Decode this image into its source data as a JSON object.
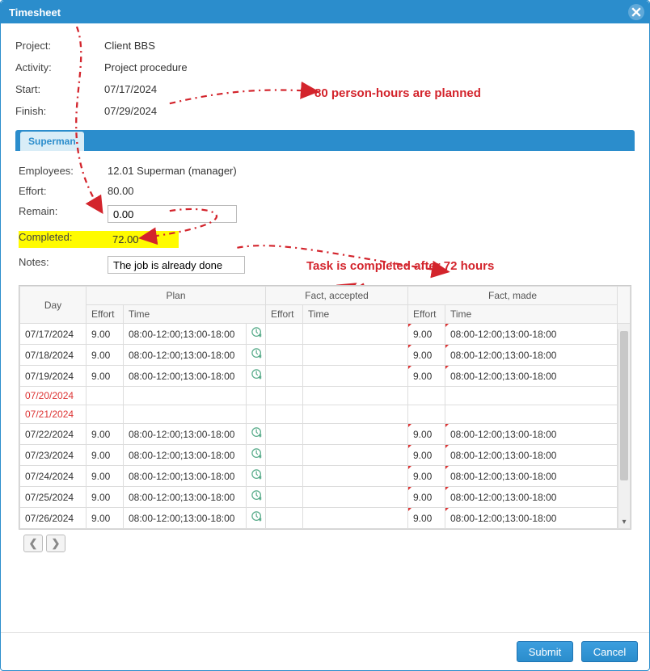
{
  "dialog": {
    "title": "Timesheet"
  },
  "summary": {
    "project_label": "Project:",
    "project_value": "Client BBS",
    "activity_label": "Activity:",
    "activity_value": "Project procedure",
    "start_label": "Start:",
    "start_value": "07/17/2024",
    "finish_label": "Finish:",
    "finish_value": "07/29/2024"
  },
  "tab": {
    "label": "Superman"
  },
  "panel": {
    "employees_label": "Employees:",
    "employees_value": "12.01 Superman (manager)",
    "effort_label": "Effort:",
    "effort_value": "80.00",
    "remain_label": "Remain:",
    "remain_value": "0.00",
    "completed_label": "Completed:",
    "completed_value": "72.00",
    "notes_label": "Notes:",
    "notes_value": "The job is already done"
  },
  "grid": {
    "headers": {
      "day": "Day",
      "plan": "Plan",
      "fact_accepted": "Fact, accepted",
      "fact_made": "Fact, made",
      "effort": "Effort",
      "time": "Time"
    },
    "rows": [
      {
        "day": "07/17/2024",
        "plan_effort": "9.00",
        "plan_time": "08:00-12:00;13:00-18:00",
        "fa_effort": "",
        "fa_time": "",
        "fm_effort": "9.00",
        "fm_time": "08:00-12:00;13:00-18:00",
        "weekend": false
      },
      {
        "day": "07/18/2024",
        "plan_effort": "9.00",
        "plan_time": "08:00-12:00;13:00-18:00",
        "fa_effort": "",
        "fa_time": "",
        "fm_effort": "9.00",
        "fm_time": "08:00-12:00;13:00-18:00",
        "weekend": false
      },
      {
        "day": "07/19/2024",
        "plan_effort": "9.00",
        "plan_time": "08:00-12:00;13:00-18:00",
        "fa_effort": "",
        "fa_time": "",
        "fm_effort": "9.00",
        "fm_time": "08:00-12:00;13:00-18:00",
        "weekend": false
      },
      {
        "day": "07/20/2024",
        "plan_effort": "",
        "plan_time": "",
        "fa_effort": "",
        "fa_time": "",
        "fm_effort": "",
        "fm_time": "",
        "weekend": true
      },
      {
        "day": "07/21/2024",
        "plan_effort": "",
        "plan_time": "",
        "fa_effort": "",
        "fa_time": "",
        "fm_effort": "",
        "fm_time": "",
        "weekend": true
      },
      {
        "day": "07/22/2024",
        "plan_effort": "9.00",
        "plan_time": "08:00-12:00;13:00-18:00",
        "fa_effort": "",
        "fa_time": "",
        "fm_effort": "9.00",
        "fm_time": "08:00-12:00;13:00-18:00",
        "weekend": false
      },
      {
        "day": "07/23/2024",
        "plan_effort": "9.00",
        "plan_time": "08:00-12:00;13:00-18:00",
        "fa_effort": "",
        "fa_time": "",
        "fm_effort": "9.00",
        "fm_time": "08:00-12:00;13:00-18:00",
        "weekend": false
      },
      {
        "day": "07/24/2024",
        "plan_effort": "9.00",
        "plan_time": "08:00-12:00;13:00-18:00",
        "fa_effort": "",
        "fa_time": "",
        "fm_effort": "9.00",
        "fm_time": "08:00-12:00;13:00-18:00",
        "weekend": false
      },
      {
        "day": "07/25/2024",
        "plan_effort": "9.00",
        "plan_time": "08:00-12:00;13:00-18:00",
        "fa_effort": "",
        "fa_time": "",
        "fm_effort": "9.00",
        "fm_time": "08:00-12:00;13:00-18:00",
        "weekend": false
      },
      {
        "day": "07/26/2024",
        "plan_effort": "9.00",
        "plan_time": "08:00-12:00;13:00-18:00",
        "fa_effort": "",
        "fa_time": "",
        "fm_effort": "9.00",
        "fm_time": "08:00-12:00;13:00-18:00",
        "weekend": false
      }
    ]
  },
  "footer": {
    "submit": "Submit",
    "cancel": "Cancel"
  },
  "annotations": {
    "a1": "80 person-hours are planned",
    "a2": "Task is completed after 72 hours"
  }
}
